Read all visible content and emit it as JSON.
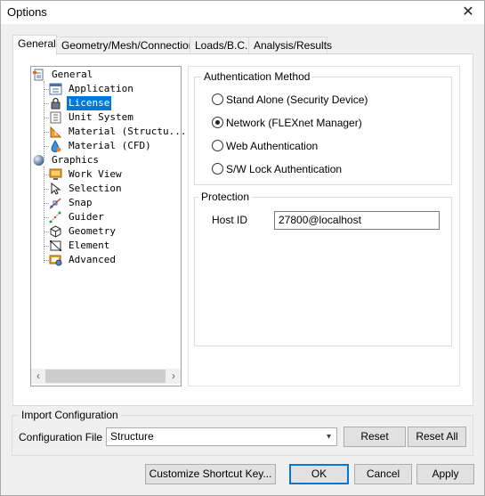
{
  "window": {
    "title": "Options"
  },
  "tabs": [
    {
      "label": "General",
      "active": true
    },
    {
      "label": "Geometry/Mesh/Connections",
      "active": false
    },
    {
      "label": "Loads/B.C.",
      "active": false
    },
    {
      "label": "Analysis/Results",
      "active": false
    }
  ],
  "tree": {
    "general": "General",
    "application": "Application",
    "license": "License",
    "unit_system": "Unit System",
    "material_structure": "Material (Structu...",
    "material_cfd": "Material (CFD)",
    "graphics": "Graphics",
    "work_view": "Work View",
    "selection": "Selection",
    "snap": "Snap",
    "guider": "Guider",
    "geometry": "Geometry",
    "element": "Element",
    "advanced": "Advanced"
  },
  "auth": {
    "title": "Authentication Method",
    "options": [
      {
        "label": "Stand Alone (Security Device)",
        "checked": false
      },
      {
        "label": "Network (FLEXnet Manager)",
        "checked": true
      },
      {
        "label": "Web Authentication",
        "checked": false
      },
      {
        "label": "S/W Lock Authentication",
        "checked": false
      }
    ]
  },
  "protection": {
    "title": "Protection",
    "host_id_label": "Host ID",
    "host_id_value": "27800@localhost"
  },
  "import_config": {
    "title": "Import Configuration",
    "file_label": "Configuration File",
    "file_value": "Structure",
    "reset_label": "Reset",
    "reset_all_label": "Reset All"
  },
  "footer": {
    "customize_label": "Customize Shortcut Key...",
    "ok_label": "OK",
    "cancel_label": "Cancel",
    "apply_label": "Apply"
  },
  "colors": {
    "selection": "#0078d7",
    "default_button_border": "#0078d7"
  }
}
